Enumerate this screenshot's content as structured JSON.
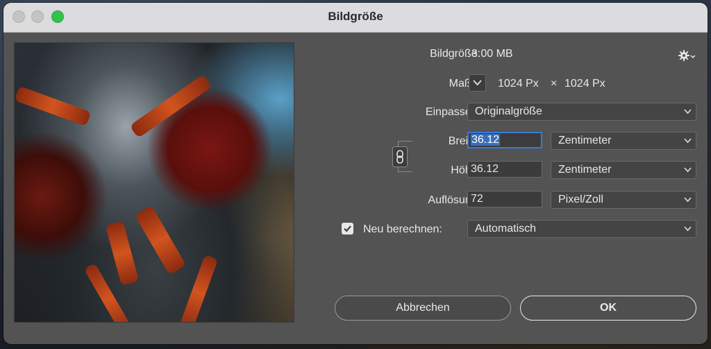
{
  "window": {
    "title": "Bildgröße"
  },
  "info": {
    "size_label": "Bildgröße:",
    "size_value": "3.00 MB",
    "dims_label": "Maße:",
    "dims_width": "1024 Px",
    "dims_times": "×",
    "dims_height": "1024 Px"
  },
  "fit": {
    "label": "Einpassen:",
    "value": "Originalgröße"
  },
  "width": {
    "label": "Breite:",
    "value": "36.12",
    "unit": "Zentimeter"
  },
  "height": {
    "label": "Höhe:",
    "value": "36.12",
    "unit": "Zentimeter"
  },
  "resolution": {
    "label": "Auflösung:",
    "value": "72",
    "unit": "Pixel/Zoll"
  },
  "resample": {
    "label": "Neu berechnen:",
    "checked": true,
    "value": "Automatisch"
  },
  "buttons": {
    "cancel": "Abbrechen",
    "ok": "OK"
  },
  "icons": {
    "gear": "gear-icon",
    "link": "link-icon",
    "chevron": "chevron-down-icon",
    "check": "checkmark-icon"
  },
  "colors": {
    "focus": "#3a7bd5",
    "zoom_button": "#32c24d"
  }
}
